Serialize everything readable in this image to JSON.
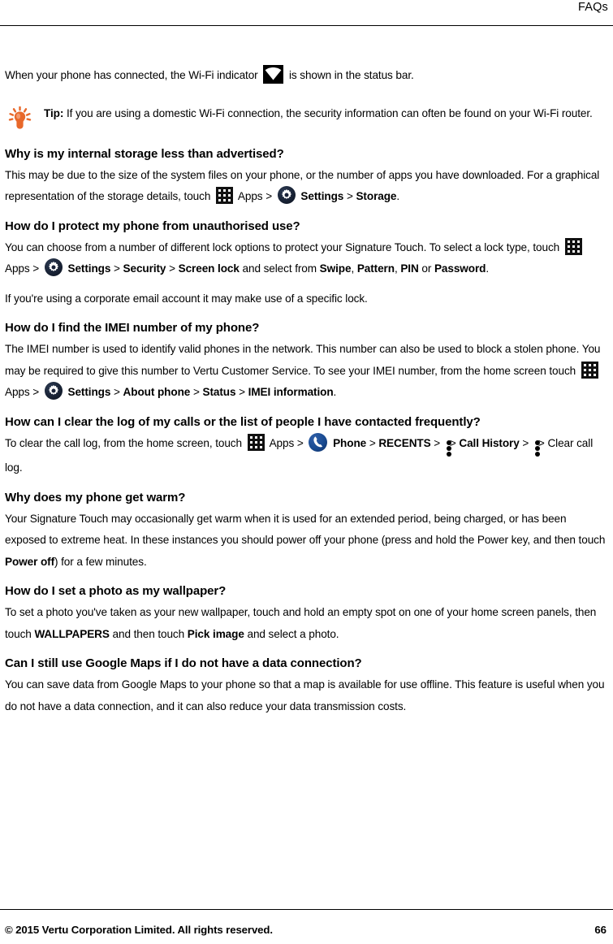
{
  "header": {
    "title": "FAQs"
  },
  "intro": {
    "before_icon": "When your phone has connected, the Wi-Fi indicator",
    "wifi_icon_name": "wifi-indicator-icon",
    "after_icon": "is shown in the status bar."
  },
  "tip": {
    "icon_name": "lightbulb-tip-icon",
    "label": "Tip:",
    "text": "If you are using a domestic Wi-Fi connection, the security information can often be found on your Wi-Fi router."
  },
  "sections": [
    {
      "heading": "Why is my internal storage less than advertised?",
      "body_1": "This may be due to the size of the system files on your phone, or the number of apps you have downloaded. For a graphical representation of the storage details, touch",
      "apps_label": "Apps",
      "sep": ">",
      "settings_label": "Settings",
      "tail_bold": "Storage",
      "tail_period": "."
    },
    {
      "heading": "How do I protect my phone from unauthorised use?",
      "body_1": "You can choose from a number of different lock options to protect your Signature Touch. To select a lock type, touch",
      "apps_label": "Apps",
      "settings_label": "Settings",
      "security_label": "Security",
      "screen_lock_label": "Screen lock",
      "mid_text": "and select from",
      "opt_1": "Swipe",
      "opt_2": "Pattern",
      "opt_3": "PIN",
      "or_text": "or",
      "opt_4": "Password",
      "tail_period": ".",
      "body_2": "If you're using a corporate email account it may make use of a specific lock."
    },
    {
      "heading": "How do I find the IMEI number of my phone?",
      "body_1": "The IMEI number is used to identify valid phones in the network. This number can also be used to block a stolen phone. You may be required to give this number to Vertu Customer Service. To see your IMEI number, from the home screen touch",
      "apps_label": "Apps",
      "settings_label": "Settings",
      "about_phone_label": "About phone",
      "status_label": "Status",
      "imei_info_label": "IMEI information",
      "tail_period": "."
    },
    {
      "heading": "How can I clear the log of my calls or the list of people I have contacted frequently?",
      "body_1": "To clear the call log, from the home screen, touch",
      "apps_label": "Apps",
      "phone_label": "Phone",
      "recents_label": "RECENTS",
      "call_history_label": "Call History",
      "clear_call_log_label": "Clear call log.",
      "overflow_icon_name": "overflow-menu-icon"
    },
    {
      "heading": "Why does my phone get warm?",
      "body_1": "Your Signature Touch may occasionally get warm when it is used for an extended period, being charged, or has been exposed to extreme heat. In these instances you should power off your phone (press and hold the Power key, and then touch",
      "power_off_label": "Power off",
      "body_2": ") for a few minutes."
    },
    {
      "heading": "How do I set a photo as my wallpaper?",
      "body_1": "To set a photo you've taken as your new wallpaper, touch and hold an empty spot on one of your home screen panels, then touch",
      "wallpapers_label": "WALLPAPERS",
      "mid_text": "and then touch",
      "pick_image_label": "Pick image",
      "body_2": "and select a photo."
    },
    {
      "heading": "Can I still use Google Maps if I do not have a data connection?",
      "body_1": "You can save data from Google Maps to your phone so that a map is available for use offline. This feature is useful when you do not have a data connection, and it can also reduce your data transmission costs."
    }
  ],
  "footer": {
    "copyright": "© 2015 Vertu Corporation Limited. All rights reserved.",
    "page_number": "66"
  },
  "colors": {
    "tip_orange": "#E8682A",
    "settings_navy": "#182238",
    "phone_blue": "#1A4E96",
    "text_black": "#000000"
  }
}
